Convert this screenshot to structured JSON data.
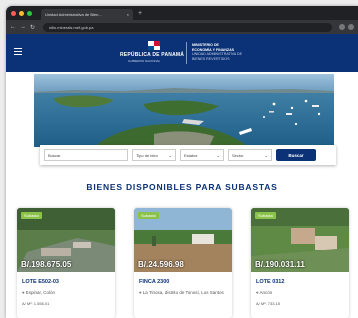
{
  "browser": {
    "tab_title": "Unidad Administrativa de Bien...",
    "close_glyph": "×",
    "new_tab_glyph": "+",
    "url": "sitio.minerals.mef.gob.pa"
  },
  "header": {
    "republic": "REPÚBLICA DE PANAMÁ",
    "republic_sub": "GOBIERNO NACIONAL",
    "ministry_line1": "MINISTERIO DE",
    "ministry_line2": "ECONOMÍA Y FINANZAS",
    "ministry_line3": "UNIDAD ADMINISTRATIVA DE",
    "ministry_line4": "BIENES REVERTIDOS"
  },
  "search": {
    "field1": "Buscar",
    "field2": "Tipo de bien",
    "field3": "Estatus",
    "field4": "Sector",
    "button": "Buscar"
  },
  "section_title": "BIENES DISPONIBLES PARA SUBASTAS",
  "cards": [
    {
      "badge": "Subasta",
      "price": "B/.198.675.05",
      "name": "LOTE E502-03",
      "location": "Espinar, Colón",
      "area": "A/ M²: 1.556.01"
    },
    {
      "badge": "Subasta",
      "price": "B/.24.596.98",
      "name": "FINCA 2300",
      "location": "La Tinosa, distrito de Tonosí, Los Santos",
      "area": ""
    },
    {
      "badge": "Subasta",
      "price": "B/.190.031.11",
      "name": "LOTE 0312",
      "location": "Ancón",
      "area": "A/ M²: 733.15"
    }
  ],
  "colors": {
    "brand": "#0b3277",
    "badge": "#8bc34a"
  }
}
